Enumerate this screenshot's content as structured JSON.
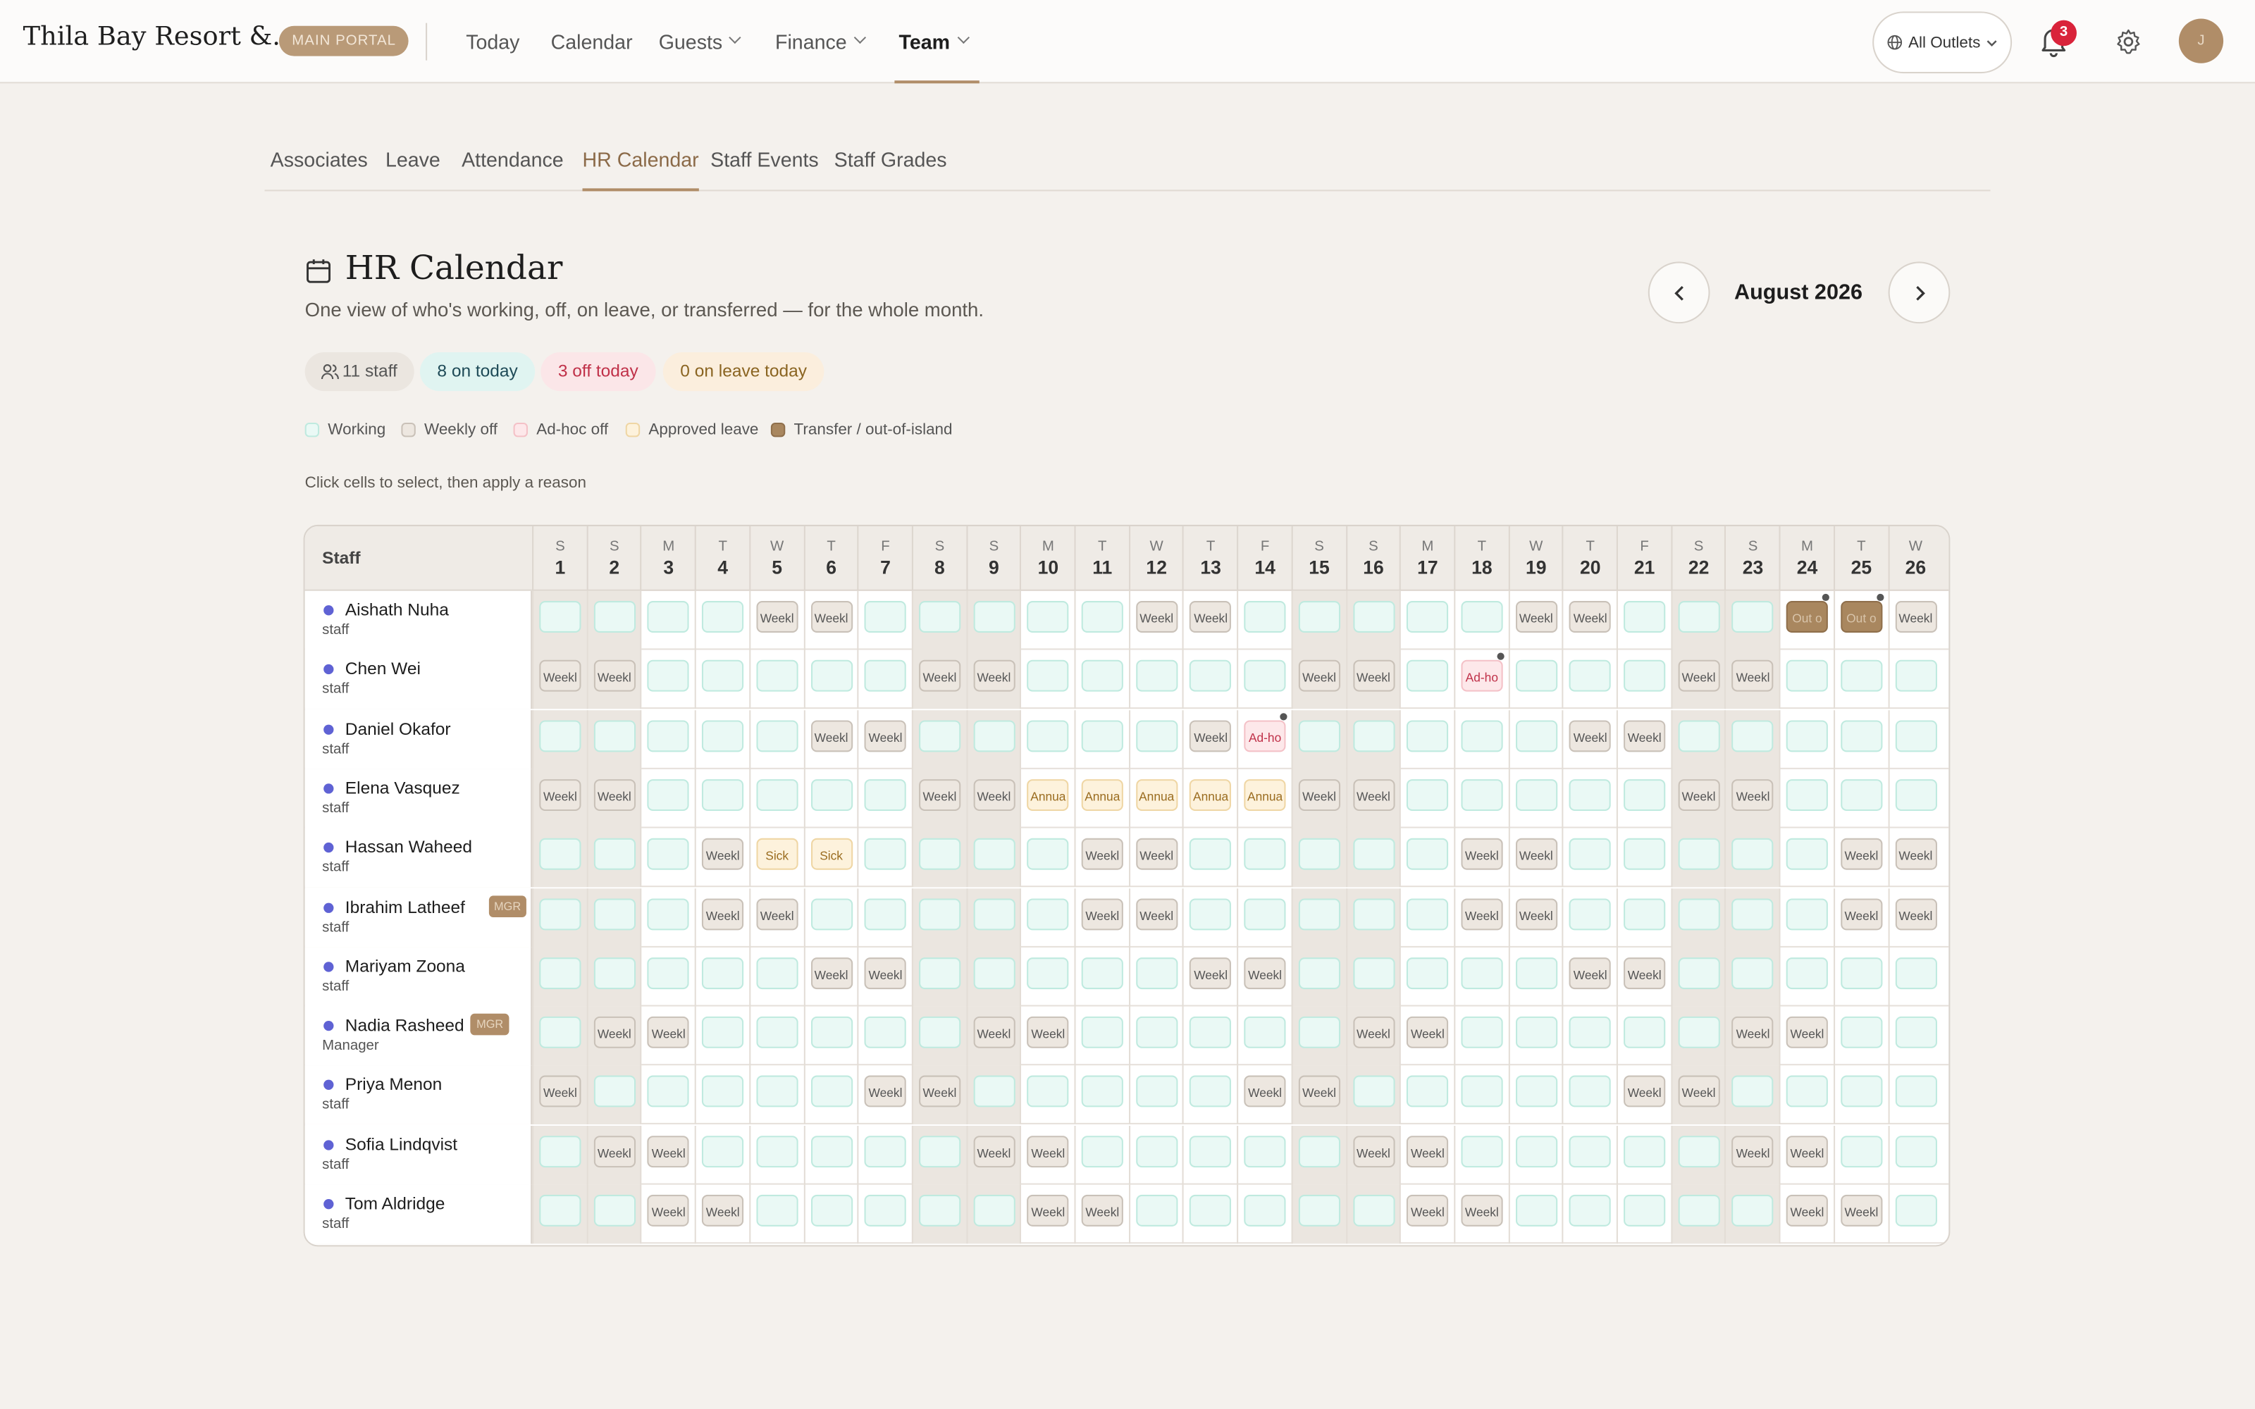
{
  "app": {
    "brand": "Thila Bay Resort &...",
    "portal_badge": "MAIN PORTAL",
    "avatar_initial": "J",
    "notifications": "3",
    "outlets_label": "All Outlets"
  },
  "nav": [
    {
      "label": "Today"
    },
    {
      "label": "Calendar"
    },
    {
      "label": "Guests"
    },
    {
      "label": "Finance"
    },
    {
      "label": "Team"
    }
  ],
  "subtabs": [
    "Associates",
    "Leave",
    "Attendance",
    "HR Calendar",
    "Staff Events",
    "Staff Grades"
  ],
  "page": {
    "title": "HR Calendar",
    "subtitle": "One view of who's working, off, on leave, or transferred — for the whole month.",
    "month": "August 2026",
    "hint": "Click cells to select, then apply a reason"
  },
  "stats": {
    "staff": "11 staff",
    "on_today": "8 on today",
    "off_today": "3 off today",
    "leave_today": "0 on leave today"
  },
  "legend": [
    "Working",
    "Weekly off",
    "Ad-hoc off",
    "Approved leave",
    "Transfer / out-of-island"
  ],
  "colors": {
    "accent": "#b08d68",
    "working": "#eaf9f5",
    "weekly": "#ede7e0",
    "adhoc": "#fde8ea",
    "leave": "#fdf2dc",
    "transfer": "#a9875f"
  },
  "grid": {
    "staff_header": "Staff",
    "days": [
      [
        "S",
        "1"
      ],
      [
        "S",
        "2"
      ],
      [
        "M",
        "3"
      ],
      [
        "T",
        "4"
      ],
      [
        "W",
        "5"
      ],
      [
        "T",
        "6"
      ],
      [
        "F",
        "7"
      ],
      [
        "S",
        "8"
      ],
      [
        "S",
        "9"
      ],
      [
        "M",
        "10"
      ],
      [
        "T",
        "11"
      ],
      [
        "W",
        "12"
      ],
      [
        "T",
        "13"
      ],
      [
        "F",
        "14"
      ],
      [
        "S",
        "15"
      ],
      [
        "S",
        "16"
      ],
      [
        "M",
        "17"
      ],
      [
        "T",
        "18"
      ],
      [
        "W",
        "19"
      ],
      [
        "T",
        "20"
      ],
      [
        "F",
        "21"
      ],
      [
        "S",
        "22"
      ],
      [
        "S",
        "23"
      ],
      [
        "M",
        "24"
      ],
      [
        "T",
        "25"
      ],
      [
        "W",
        "26"
      ]
    ],
    "rows": [
      {
        "name": "Aishath Nuha",
        "role": "staff",
        "mgr": "",
        "cells": [
          "w",
          "w",
          "w",
          "w",
          "o",
          "o",
          "w",
          "w",
          "w",
          "w",
          "w",
          "o",
          "o",
          "w",
          "w",
          "w",
          "w",
          "w",
          "o",
          "o",
          "w",
          "w",
          "w",
          "t",
          "t",
          "o"
        ]
      },
      {
        "name": "Chen Wei",
        "role": "staff",
        "mgr": "",
        "cells": [
          "o",
          "o",
          "w",
          "w",
          "w",
          "w",
          "w",
          "o",
          "o",
          "w",
          "w",
          "w",
          "w",
          "w",
          "o",
          "o",
          "w",
          "a",
          "w",
          "w",
          "w",
          "o",
          "o",
          "w",
          "w",
          "w"
        ]
      },
      {
        "name": "Daniel Okafor",
        "role": "staff",
        "mgr": "",
        "cells": [
          "w",
          "w",
          "w",
          "w",
          "w",
          "o",
          "o",
          "w",
          "w",
          "w",
          "w",
          "w",
          "o",
          "a",
          "w",
          "w",
          "w",
          "w",
          "w",
          "o",
          "o",
          "w",
          "w",
          "w",
          "w",
          "w"
        ]
      },
      {
        "name": "Elena Vasquez",
        "role": "staff",
        "mgr": "",
        "cells": [
          "o",
          "o",
          "w",
          "w",
          "w",
          "w",
          "w",
          "o",
          "o",
          "l",
          "l",
          "l",
          "l",
          "l",
          "o",
          "o",
          "w",
          "w",
          "w",
          "w",
          "w",
          "o",
          "o",
          "w",
          "w",
          "w"
        ]
      },
      {
        "name": "Hassan Waheed",
        "role": "staff",
        "mgr": "",
        "cells": [
          "w",
          "w",
          "w",
          "o",
          "s",
          "s",
          "w",
          "w",
          "w",
          "w",
          "o",
          "o",
          "w",
          "w",
          "w",
          "w",
          "w",
          "o",
          "o",
          "w",
          "w",
          "w",
          "w",
          "w",
          "o",
          "o"
        ]
      },
      {
        "name": "Ibrahim Latheef",
        "role": "staff",
        "mgr": "MGR",
        "cells": [
          "w",
          "w",
          "w",
          "o",
          "o",
          "w",
          "w",
          "w",
          "w",
          "w",
          "o",
          "o",
          "w",
          "w",
          "w",
          "w",
          "w",
          "o",
          "o",
          "w",
          "w",
          "w",
          "w",
          "w",
          "o",
          "o"
        ]
      },
      {
        "name": "Mariyam Zoona",
        "role": "staff",
        "mgr": "",
        "cells": [
          "w",
          "w",
          "w",
          "w",
          "w",
          "o",
          "o",
          "w",
          "w",
          "w",
          "w",
          "w",
          "o",
          "o",
          "w",
          "w",
          "w",
          "w",
          "w",
          "o",
          "o",
          "w",
          "w",
          "w",
          "w",
          "w"
        ]
      },
      {
        "name": "Nadia Rasheed",
        "role": "Manager",
        "mgr": "MGR",
        "cells": [
          "w",
          "o",
          "o",
          "w",
          "w",
          "w",
          "w",
          "w",
          "o",
          "o",
          "w",
          "w",
          "w",
          "w",
          "w",
          "o",
          "o",
          "w",
          "w",
          "w",
          "w",
          "w",
          "o",
          "o",
          "w",
          "w"
        ]
      },
      {
        "name": "Priya Menon",
        "role": "staff",
        "mgr": "",
        "cells": [
          "o",
          "w",
          "w",
          "w",
          "w",
          "w",
          "o",
          "o",
          "w",
          "w",
          "w",
          "w",
          "w",
          "o",
          "o",
          "w",
          "w",
          "w",
          "w",
          "w",
          "o",
          "o",
          "w",
          "w",
          "w",
          "w"
        ]
      },
      {
        "name": "Sofia Lindqvist",
        "role": "staff",
        "mgr": "",
        "cells": [
          "w",
          "o",
          "o",
          "w",
          "w",
          "w",
          "w",
          "w",
          "o",
          "o",
          "w",
          "w",
          "w",
          "w",
          "w",
          "o",
          "o",
          "w",
          "w",
          "w",
          "w",
          "w",
          "o",
          "o",
          "w",
          "w"
        ]
      },
      {
        "name": "Tom Aldridge",
        "role": "staff",
        "mgr": "",
        "cells": [
          "w",
          "w",
          "o",
          "o",
          "w",
          "w",
          "w",
          "w",
          "w",
          "o",
          "o",
          "w",
          "w",
          "w",
          "w",
          "w",
          "o",
          "o",
          "w",
          "w",
          "w",
          "w",
          "w",
          "o",
          "o",
          "w"
        ]
      }
    ],
    "labels": {
      "o": "Weekl",
      "l": "Annua",
      "s": "Sick",
      "a": "Ad-ho",
      "t": "Out o"
    }
  }
}
